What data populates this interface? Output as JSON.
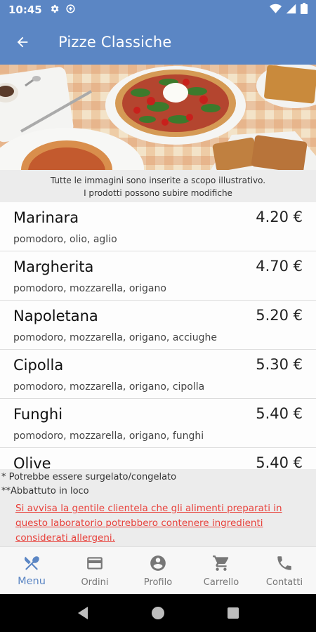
{
  "status_bar": {
    "time": "10:45"
  },
  "app_bar": {
    "title": "Pizze Classiche"
  },
  "disclaimer": {
    "line1": "Tutte le immagini sono inserite a scopo illustrativo.",
    "line2": "I prodotti possono subire modifiche"
  },
  "menu": {
    "items": [
      {
        "name": "Marinara",
        "price": "4.20 €",
        "description": "pomodoro, olio, aglio"
      },
      {
        "name": "Margherita",
        "price": "4.70 €",
        "description": "pomodoro, mozzarella, origano"
      },
      {
        "name": "Napoletana",
        "price": "5.20 €",
        "description": "pomodoro, mozzarella, origano, acciughe"
      },
      {
        "name": "Cipolla",
        "price": "5.30 €",
        "description": "pomodoro, mozzarella, origano, cipolla"
      },
      {
        "name": "Funghi",
        "price": "5.40 €",
        "description": "pomodoro, mozzarella, origano, funghi"
      },
      {
        "name": "Olive",
        "price": "5.40 €",
        "description": ""
      }
    ]
  },
  "notes": {
    "frozen": "* Potrebbe essere surgelato/congelato",
    "blast_chilled": "**Abbattuto in loco",
    "allergen_warning": "Si avvisa la gentile clientela che gli alimenti preparati in questo laboratorio potrebbero contenere ingredienti considerati allergeni."
  },
  "bottom_nav": {
    "items": [
      {
        "label": "Menu",
        "icon": "cutlery-icon",
        "active": true
      },
      {
        "label": "Ordini",
        "icon": "card-icon",
        "active": false
      },
      {
        "label": "Profilo",
        "icon": "account-icon",
        "active": false
      },
      {
        "label": "Carrello",
        "icon": "cart-icon",
        "active": false
      },
      {
        "label": "Contatti",
        "icon": "phone-icon",
        "active": false
      }
    ]
  },
  "colors": {
    "primary": "#5b86c4",
    "warning_text": "#e8413b",
    "inactive_nav": "#777777"
  }
}
